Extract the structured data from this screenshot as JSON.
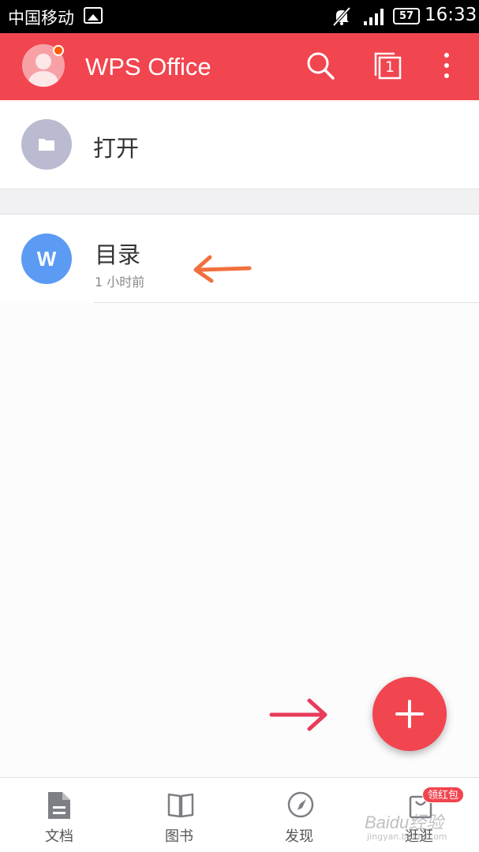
{
  "status_bar": {
    "carrier": "中国移动",
    "battery": "57",
    "time": "16:33",
    "icons": [
      "image-icon",
      "mute-icon",
      "signal-icon",
      "battery-icon"
    ]
  },
  "header": {
    "title": "WPS Office",
    "icons": [
      "avatar",
      "search-icon",
      "tabs-icon",
      "more-icon"
    ],
    "tab_count": "1",
    "accent": "#f1454f"
  },
  "open": {
    "label": "打开",
    "icon": "folder-icon"
  },
  "files": [
    {
      "name": "目录",
      "time": "1 小时前",
      "type_letter": "W",
      "color": "#5c9bf3"
    }
  ],
  "fab": {
    "icon": "plus-icon"
  },
  "bottom_nav": {
    "items": [
      {
        "label": "文档",
        "icon": "document-icon"
      },
      {
        "label": "图书",
        "icon": "book-icon"
      },
      {
        "label": "发现",
        "icon": "compass-icon"
      },
      {
        "label": "逛逛",
        "icon": "shop-icon"
      }
    ],
    "badge": "领红包"
  },
  "watermark": {
    "text": "Baidu经验",
    "sub": "jingyan.baidu.com"
  }
}
